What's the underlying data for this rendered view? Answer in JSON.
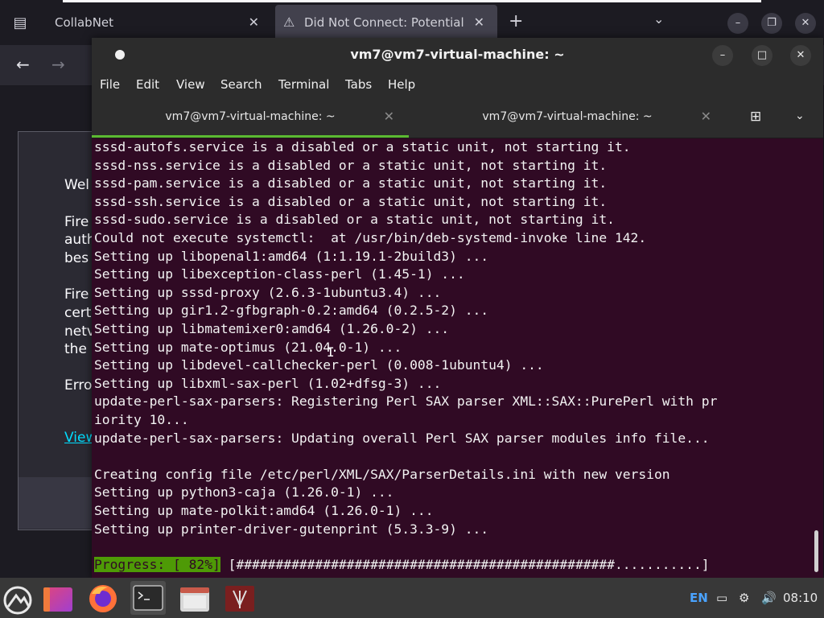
{
  "browser": {
    "tabs": [
      {
        "label": "CollabNet"
      },
      {
        "label": "Did Not Connect: Potential S"
      }
    ],
    "error_fragments": [
      "Wel",
      "Fire",
      "auth",
      "bes",
      "Fire",
      "cert",
      "netv",
      "the",
      "Erro",
      "View"
    ]
  },
  "terminal": {
    "title": "vm7@vm7-virtual-machine: ~",
    "menu": [
      "File",
      "Edit",
      "View",
      "Search",
      "Terminal",
      "Tabs",
      "Help"
    ],
    "tabs": [
      {
        "label": "vm7@vm7-virtual-machine: ~"
      },
      {
        "label": "vm7@vm7-virtual-machine: ~"
      }
    ],
    "lines": [
      "sssd-autofs.service is a disabled or a static unit, not starting it.",
      "sssd-nss.service is a disabled or a static unit, not starting it.",
      "sssd-pam.service is a disabled or a static unit, not starting it.",
      "sssd-ssh.service is a disabled or a static unit, not starting it.",
      "sssd-sudo.service is a disabled or a static unit, not starting it.",
      "Could not execute systemctl:  at /usr/bin/deb-systemd-invoke line 142.",
      "Setting up libopenal1:amd64 (1:1.19.1-2build3) ...",
      "Setting up libexception-class-perl (1.45-1) ...",
      "Setting up sssd-proxy (2.6.3-1ubuntu3.4) ...",
      "Setting up gir1.2-gfbgraph-0.2:amd64 (0.2.5-2) ...",
      "Setting up libmatemixer0:amd64 (1.26.0-2) ...",
      "Setting up mate-optimus (21.04.0-1) ...",
      "Setting up libdevel-callchecker-perl (0.008-1ubuntu4) ...",
      "Setting up libxml-sax-perl (1.02+dfsg-3) ...",
      "update-perl-sax-parsers: Registering Perl SAX parser XML::SAX::PurePerl with pr",
      "iority 10...",
      "update-perl-sax-parsers: Updating overall Perl SAX parser modules info file...",
      "",
      "Creating config file /etc/perl/XML/SAX/ParserDetails.ini with new version",
      "Setting up python3-caja (1.26.0-1) ...",
      "Setting up mate-polkit:amd64 (1.26.0-1) ...",
      "Setting up printer-driver-gutenprint (5.3.3-9) ..."
    ],
    "progress_label": "Progress: [ 82%]",
    "progress_bar": " [################################################...........]",
    "progress_percent": 82
  },
  "taskbar": {
    "language": "EN",
    "clock": "08:10"
  }
}
